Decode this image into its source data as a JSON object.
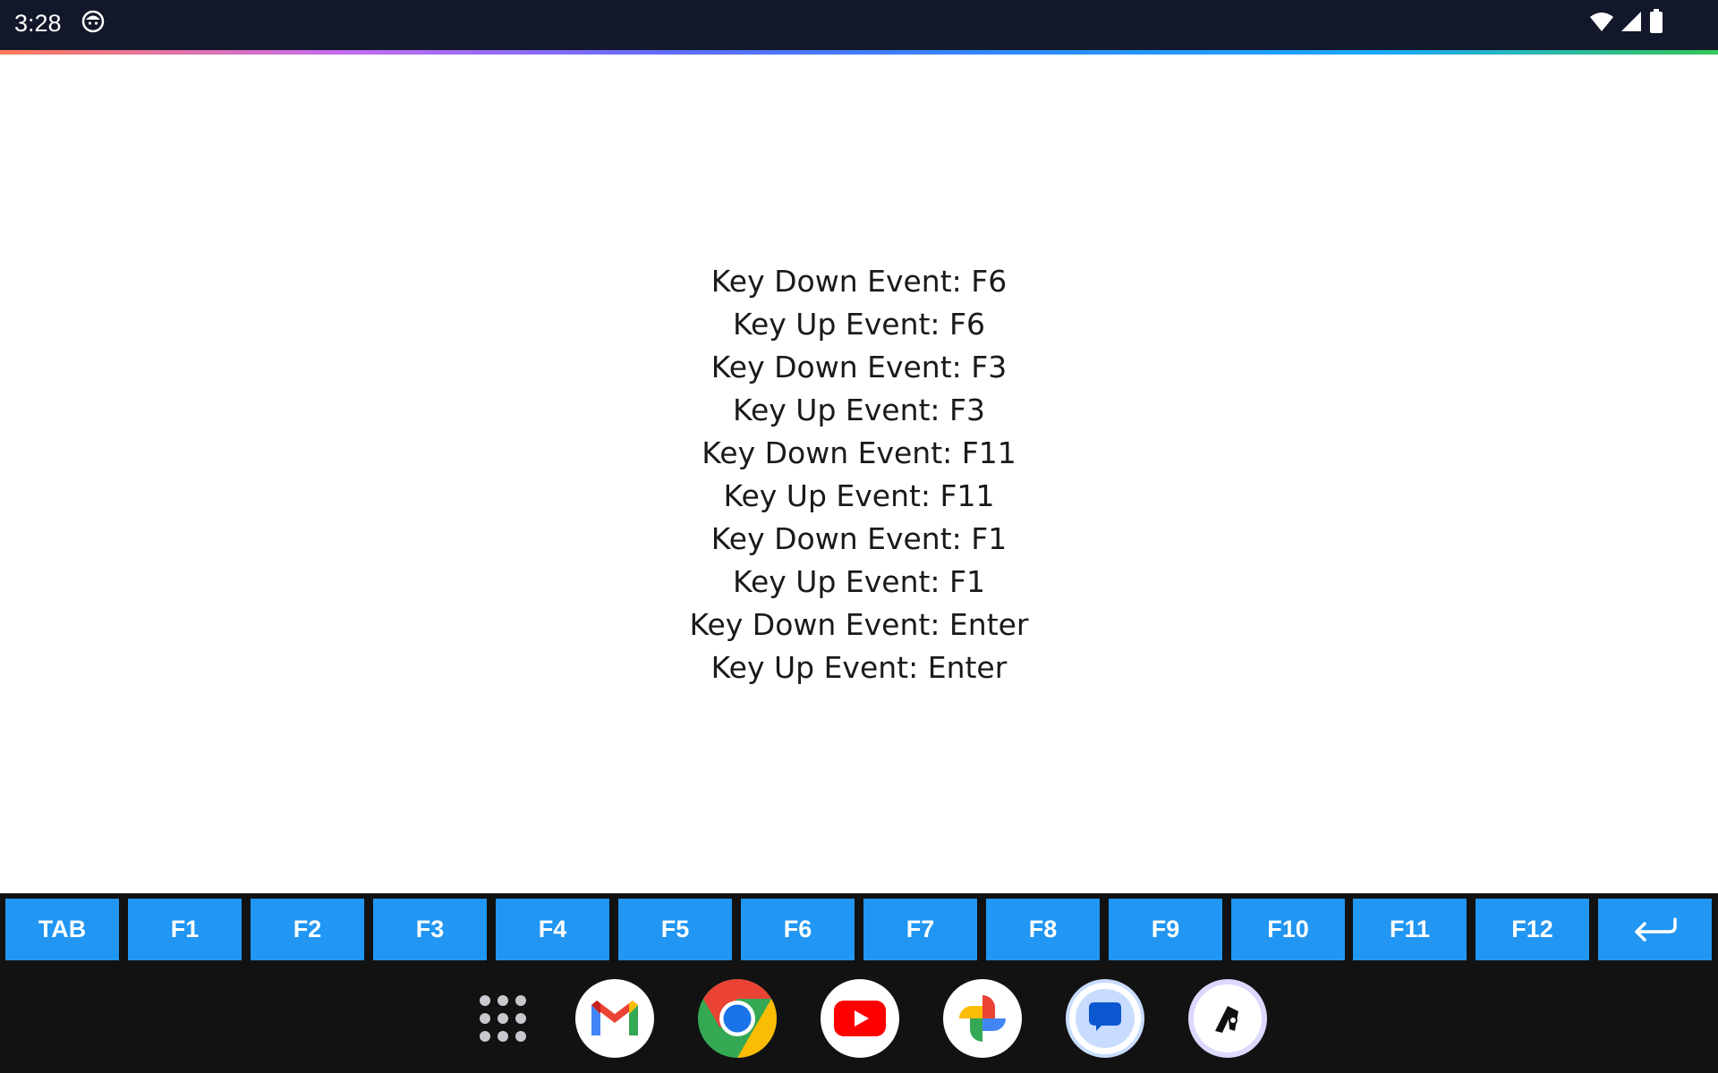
{
  "status_bar": {
    "time": "3:28",
    "icons": [
      "face-icon",
      "wifi-icon",
      "cellular-signal-icon",
      "battery-icon"
    ]
  },
  "events": [
    "Key Down Event: F6",
    "Key Up Event: F6",
    "Key Down Event: F3",
    "Key Up Event: F3",
    "Key Down Event: F11",
    "Key Up Event: F11",
    "Key Down Event: F1",
    "Key Up Event: F1",
    "Key Down Event: Enter",
    "Key Up Event: Enter"
  ],
  "key_bar": {
    "keys": [
      "TAB",
      "F1",
      "F2",
      "F3",
      "F4",
      "F5",
      "F6",
      "F7",
      "F8",
      "F9",
      "F10",
      "F11",
      "F12"
    ],
    "enter_icon": "enter-return-icon"
  },
  "dock": {
    "apps": [
      "app-grid-icon",
      "gmail-icon",
      "chrome-icon",
      "youtube-icon",
      "photos-icon",
      "messages-icon",
      "custom-app-icon"
    ]
  },
  "colors": {
    "status_bar_bg": "#121829",
    "key_button_bg": "#2196f3",
    "dock_bg": "#121212"
  }
}
